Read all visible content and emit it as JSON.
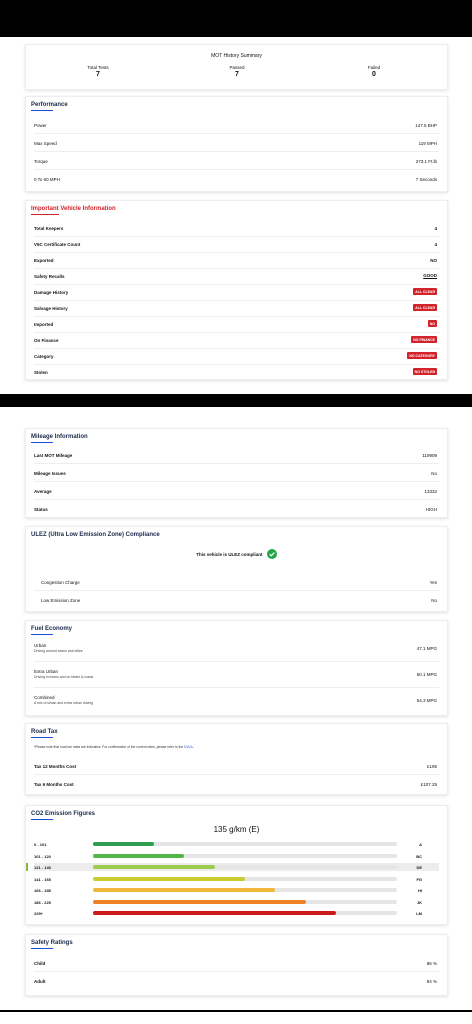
{
  "mot_summary": {
    "title": "MOT History Summary",
    "total_tests_label": "Total Tests",
    "total_tests": "7",
    "passed_label": "Passed",
    "passed": "7",
    "failed_label": "Failed",
    "failed": "0"
  },
  "performance": {
    "title": "Performance",
    "rows": [
      {
        "label": "Power",
        "value": "147.5 BHP"
      },
      {
        "label": "Max Speed",
        "value": "119 MPH"
      },
      {
        "label": "Torque",
        "value": "273.1 Ft.lb"
      },
      {
        "label": "0 To 60 MPH",
        "value": "7 Seconds"
      }
    ]
  },
  "important": {
    "title": "Important Vehicle Information",
    "rows": [
      {
        "label": "Total Keepers",
        "value": "4"
      },
      {
        "label": "V5C Certificate Count",
        "value": "4"
      },
      {
        "label": "Exported",
        "value": "NO"
      },
      {
        "label": "Safety Recalls",
        "value": "GOOD"
      },
      {
        "label": "Damage History",
        "value": "ALL CLEAR"
      },
      {
        "label": "Salvage History",
        "value": "ALL CLEAR"
      },
      {
        "label": "Imported",
        "value": "NO"
      },
      {
        "label": "On Finance",
        "value": "NO FINANCE"
      },
      {
        "label": "Category",
        "value": "NO CATEGORY"
      },
      {
        "label": "Stolen",
        "value": "NO STOLEN"
      }
    ]
  },
  "mileage": {
    "title": "Mileage Information",
    "rows": [
      {
        "label": "Last MOT Mileage",
        "value": "119909"
      },
      {
        "label": "Mileage Issues",
        "value": "No"
      },
      {
        "label": "Average",
        "value": "13332"
      },
      {
        "label": "Status",
        "value": "HIGH"
      }
    ]
  },
  "ulez": {
    "title": "ULEZ (Ultra Low Emission Zone) Compliance",
    "compliant_text": "This vehicle is ULEZ compliant",
    "rows": [
      {
        "label": "Congestion Charge",
        "value": "Yes"
      },
      {
        "label": "Low Emission Zone",
        "value": "No"
      }
    ]
  },
  "fuel": {
    "title": "Fuel Economy",
    "rows": [
      {
        "label": "Urban",
        "sub": "Driving around towns and cities",
        "value": "47.1 MPG"
      },
      {
        "label": "Extra Urban",
        "sub": "Driving in towns and on faster A-roads",
        "value": "60.1 MPG"
      },
      {
        "label": "Combined",
        "sub": "A mix of urban and extra urban driving",
        "value": "54.3 MPG"
      }
    ]
  },
  "road_tax": {
    "title": "Road Tax",
    "note": "*Please note that road tax rates are indicative. For confirmation of the current rates, please refer to the ",
    "note_link": "DVLA",
    "note_end": ".",
    "rows": [
      {
        "label": "Tax 12 Months Cost",
        "value": "£195"
      },
      {
        "label": "Tax 6 Months Cost",
        "value": "£107.25"
      }
    ]
  },
  "co2": {
    "title": "CO2 Emission Figures",
    "headline": "135 g/km (E)",
    "rows": [
      {
        "range": "0 - 101",
        "band": "A",
        "fill": 0.2,
        "color": "#2e9e4f",
        "highlight": false
      },
      {
        "range": "101 - 120",
        "band": "BC",
        "fill": 0.3,
        "color": "#52b54a",
        "highlight": false
      },
      {
        "range": "121 - 140",
        "band": "DE",
        "fill": 0.4,
        "color": "#9ccb4f",
        "highlight": true
      },
      {
        "range": "141 - 165",
        "band": "FG",
        "fill": 0.5,
        "color": "#c8cc31",
        "highlight": false
      },
      {
        "range": "166 - 185",
        "band": "HI",
        "fill": 0.6,
        "color": "#f0b73a",
        "highlight": false
      },
      {
        "range": "186 - 225",
        "band": "JK",
        "fill": 0.7,
        "color": "#ef8026",
        "highlight": false
      },
      {
        "range": "225+",
        "band": "LM",
        "fill": 0.8,
        "color": "#cc1a1a",
        "highlight": false
      }
    ]
  },
  "safety": {
    "title": "Safety Ratings",
    "rows": [
      {
        "label": "Child",
        "value": "86 %"
      },
      {
        "label": "Adult",
        "value": "94 %"
      }
    ]
  }
}
